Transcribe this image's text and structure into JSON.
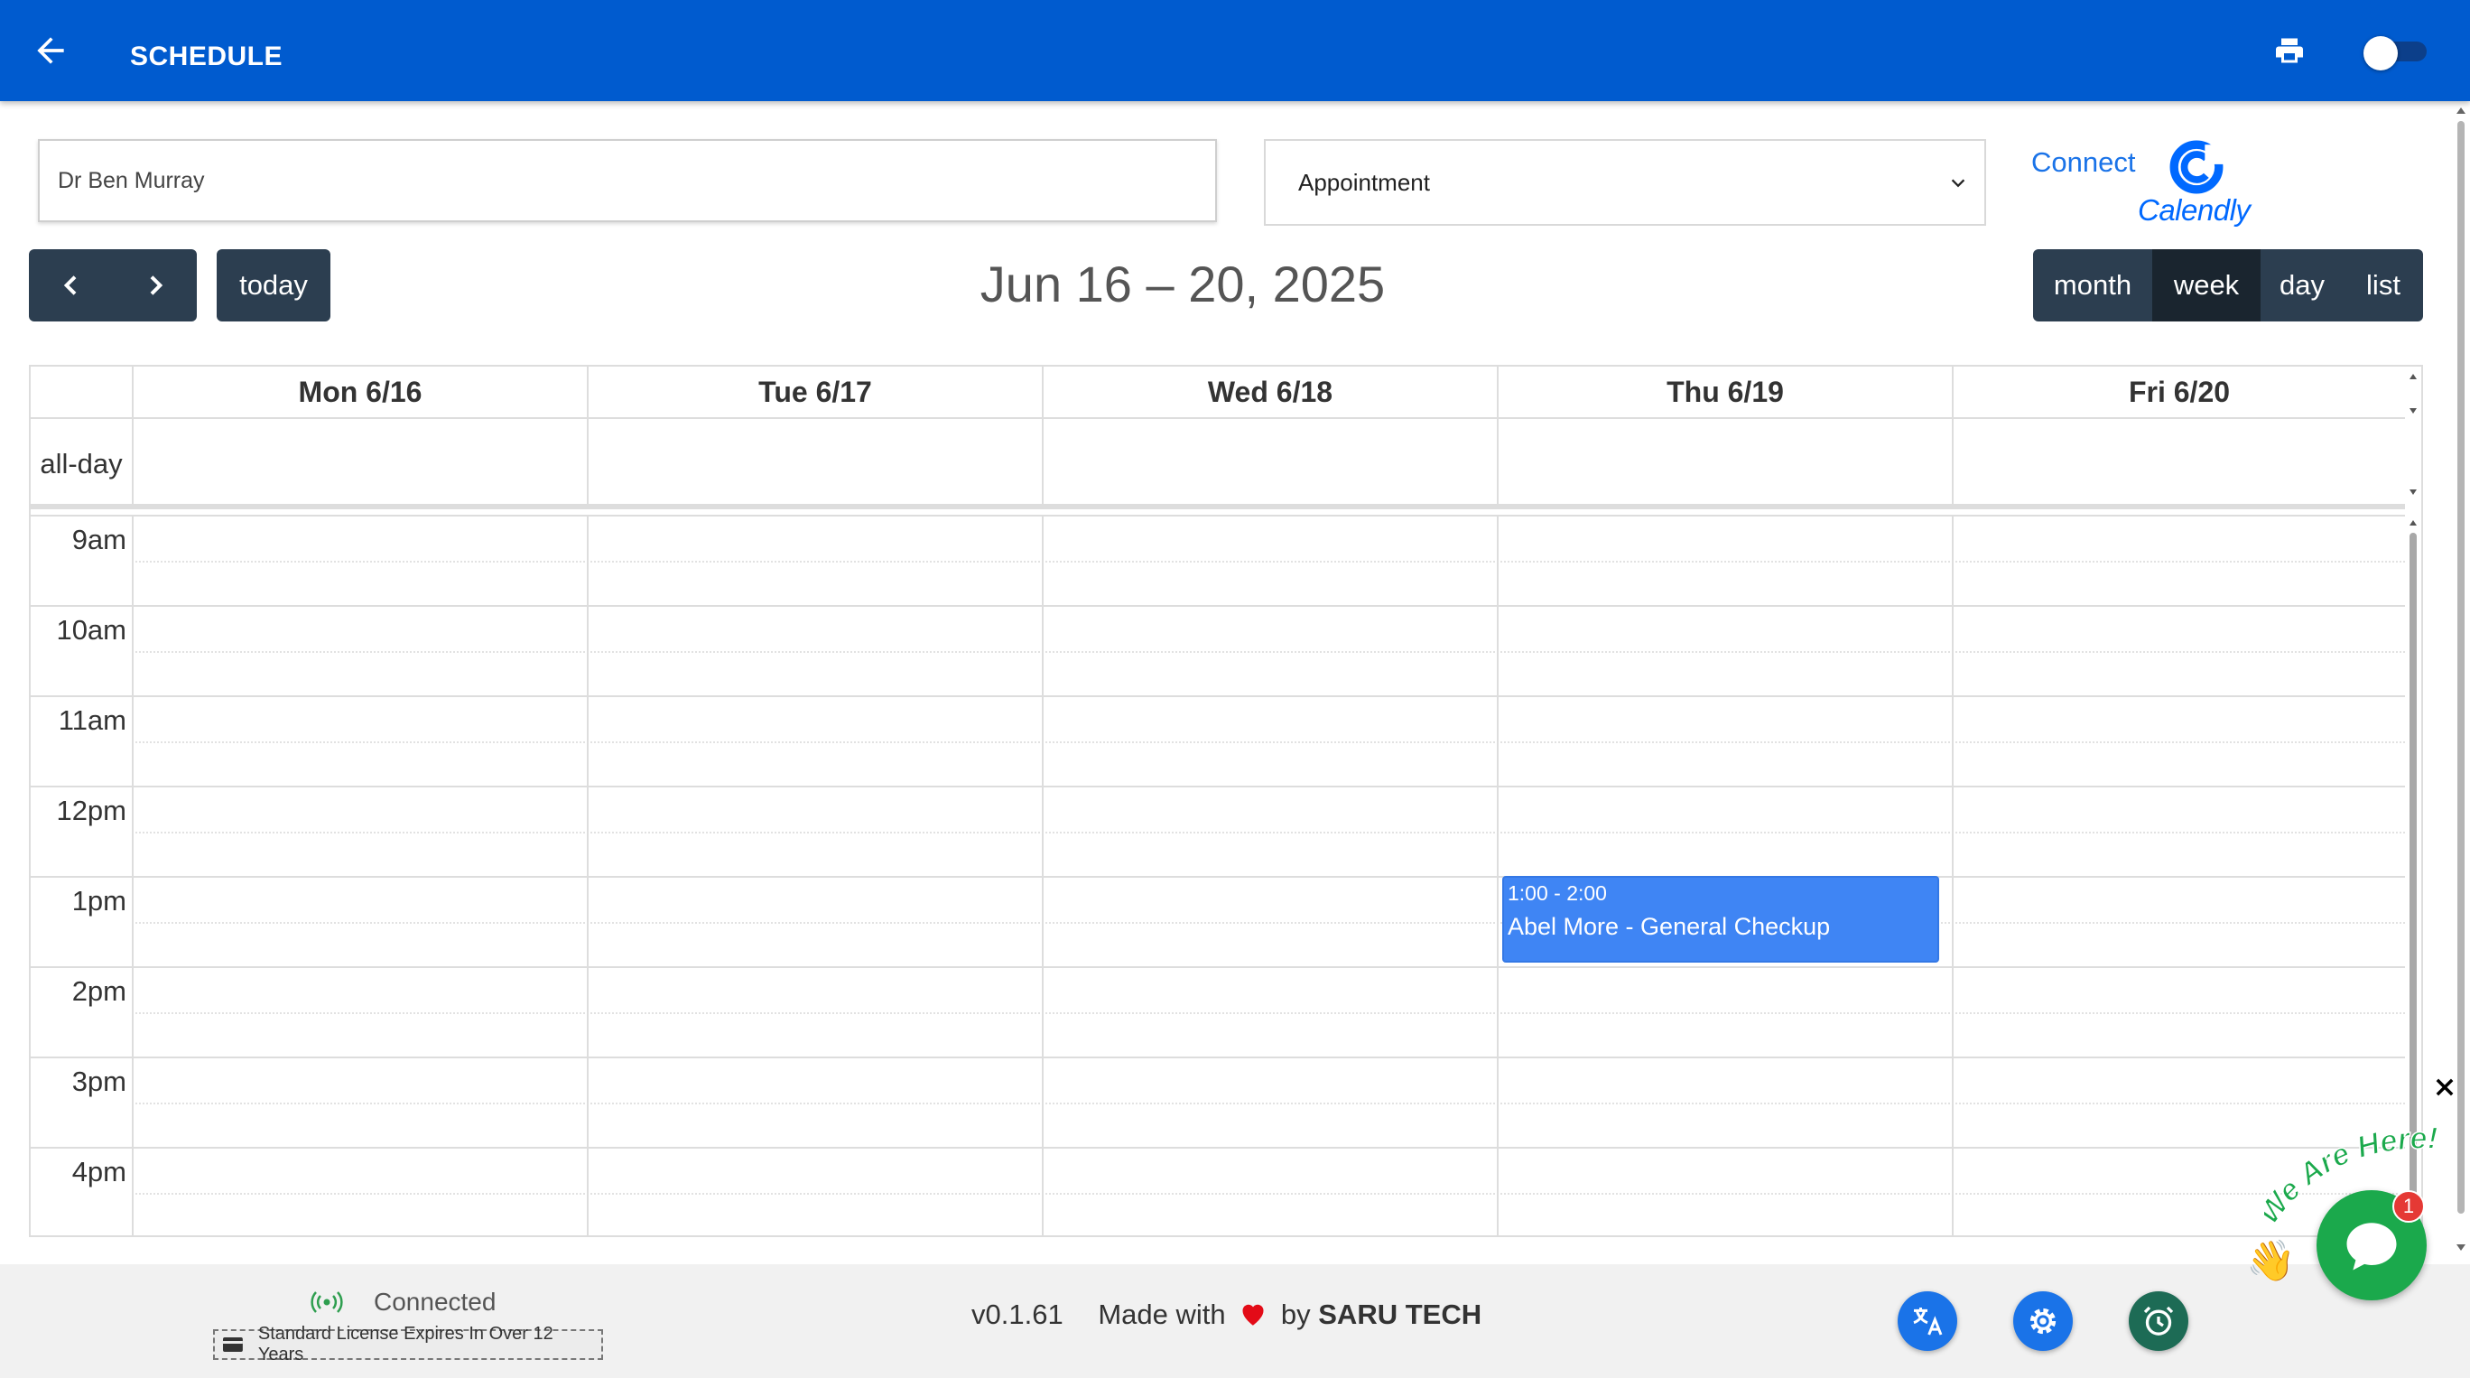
{
  "header": {
    "title": "SCHEDULE",
    "back_icon": "arrow-left-icon",
    "print_icon": "printer-icon",
    "theme_toggle": "off"
  },
  "filters": {
    "doctor_value": "Dr Ben Murray",
    "type_value": "Appointment",
    "calendly": {
      "connect_label": "Connect",
      "brand": "Calendly"
    }
  },
  "toolbar": {
    "today_label": "today",
    "range_title": "Jun 16 – 20, 2025",
    "views": [
      {
        "label": "month",
        "active": false
      },
      {
        "label": "week",
        "active": true
      },
      {
        "label": "day",
        "active": false
      },
      {
        "label": "list",
        "active": false
      }
    ]
  },
  "calendar": {
    "days": [
      "Mon 6/16",
      "Tue 6/17",
      "Wed 6/18",
      "Thu 6/19",
      "Fri 6/20"
    ],
    "allday_label": "all-day",
    "slots": [
      "9am",
      "10am",
      "11am",
      "12pm",
      "1pm",
      "2pm",
      "3pm",
      "4pm"
    ],
    "events": [
      {
        "day": "Thu 6/19",
        "time": "1:00 - 2:00",
        "title": "Abel More - General Checkup",
        "color": "#3f85f4"
      }
    ]
  },
  "footer": {
    "status": "Connected",
    "license": "Standard License Expires In Over 12 Years",
    "version": "v0.1.61",
    "made_with": "Made with",
    "by": "by",
    "brand": "SARU TECH",
    "buttons": [
      {
        "name": "translate-icon",
        "color": "#1a73e8"
      },
      {
        "name": "gear-icon",
        "color": "#1a73e8"
      },
      {
        "name": "alarm-clock-icon",
        "color": "#1d6b55"
      }
    ]
  },
  "chat": {
    "banner": "We Are Here!",
    "badge": "1"
  }
}
